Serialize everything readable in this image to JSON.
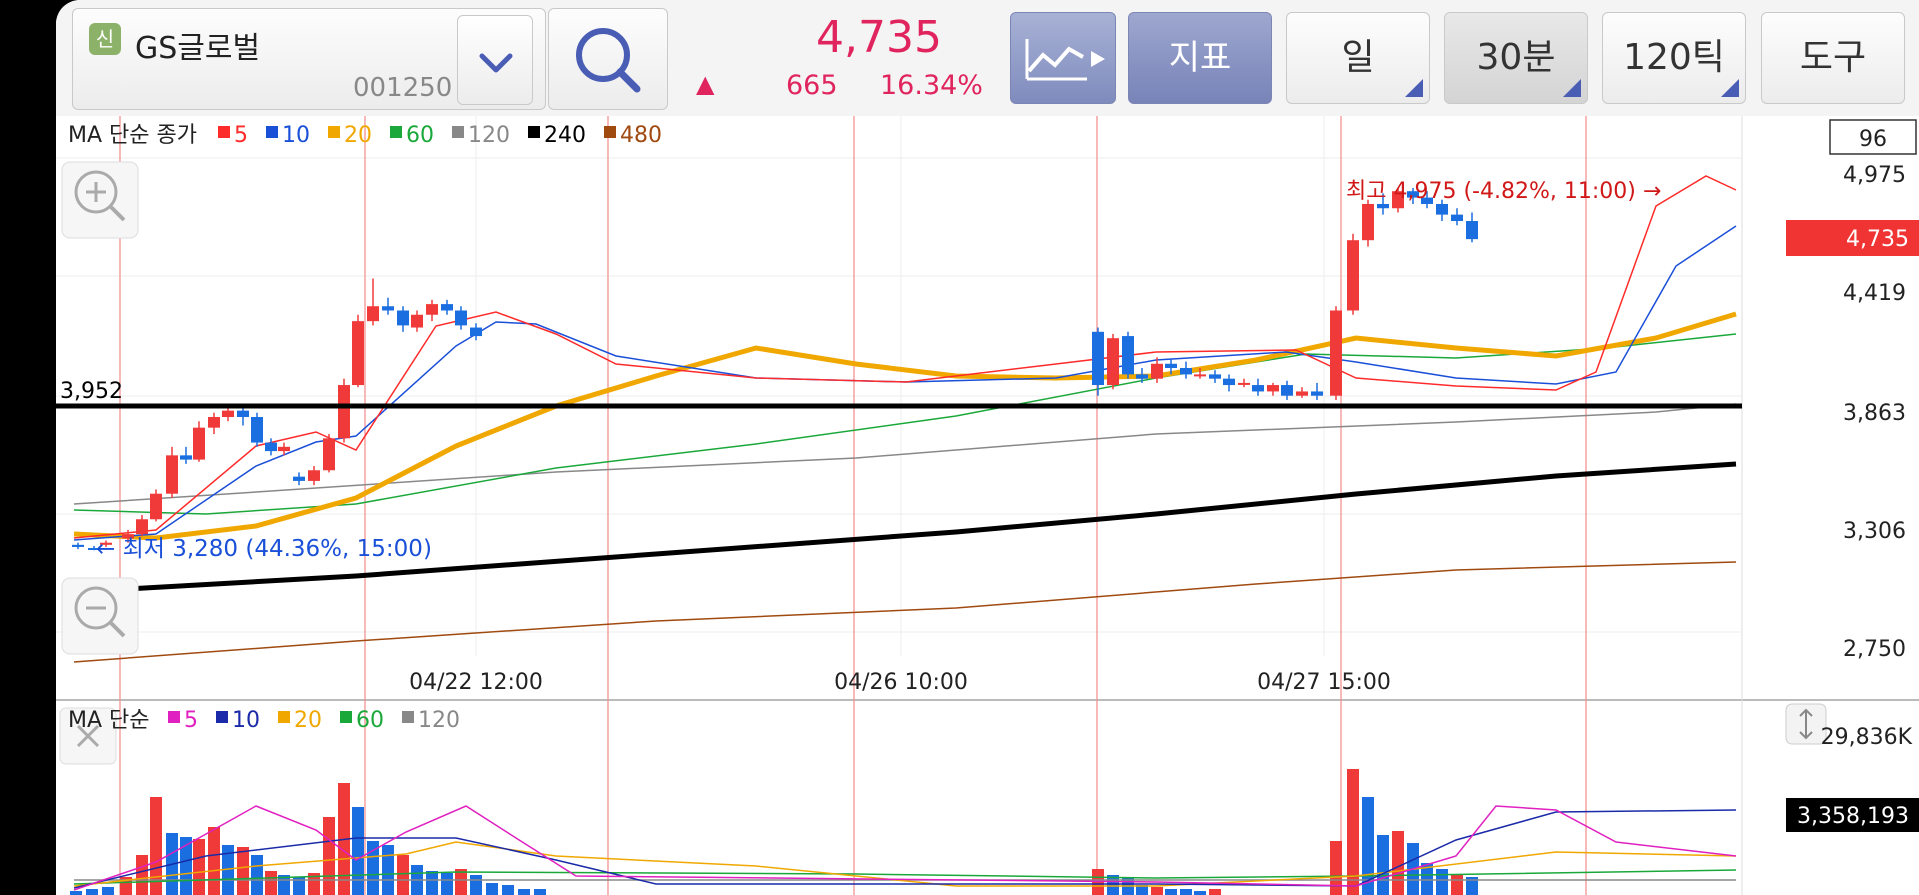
{
  "header": {
    "badge": "신",
    "stock_name": "GS글로벌",
    "stock_code": "001250",
    "price": "4,735",
    "change_arrow": "▲",
    "change_amount": "665",
    "change_percent": "16.34%",
    "indicator_label": "지표",
    "period_day": "일",
    "period_30m": "30분",
    "period_120tick": "120틱",
    "tool_label": "도구"
  },
  "price_panel": {
    "ma_title": "MA 단순 종가",
    "ma_legend": [
      {
        "label": "5",
        "color": "#ff2a2a"
      },
      {
        "label": "10",
        "color": "#1a4fd8"
      },
      {
        "label": "20",
        "color": "#f0a800"
      },
      {
        "label": "60",
        "color": "#1aa83a"
      },
      {
        "label": "120",
        "color": "#888888"
      },
      {
        "label": "240",
        "color": "#000000"
      },
      {
        "label": "480",
        "color": "#a04a10"
      }
    ],
    "count_box": "96",
    "axis_labels": [
      "4,975",
      "4,419",
      "3,863",
      "3,306",
      "2,750"
    ],
    "current_price_tag": "4,735",
    "support_line_label": "3,952",
    "high_annotation": "최고 4,975 (-4.82%, 11:00) →",
    "low_annotation": "← 최저 3,280 (44.36%, 15:00)",
    "date_labels": [
      "04/22 12:00",
      "04/26 10:00",
      "04/27 15:00"
    ]
  },
  "volume_panel": {
    "ma_title": "MA 단순",
    "ma_legend": [
      {
        "label": "5",
        "color": "#e020c0"
      },
      {
        "label": "10",
        "color": "#1a2aa8"
      },
      {
        "label": "20",
        "color": "#f0a800"
      },
      {
        "label": "60",
        "color": "#1aa83a"
      },
      {
        "label": "120",
        "color": "#888888"
      }
    ],
    "axis_top": "29,836K",
    "current_volume": "3,358,193"
  },
  "colors": {
    "up": "#f03a3a",
    "down": "#1a6ee0",
    "accent": "#e0245e",
    "button_blue": "#7f8bbd"
  },
  "icons": [
    "chevron-down-icon",
    "search-icon",
    "line-chart-icon",
    "zoom-in-icon",
    "zoom-out-icon",
    "close-icon",
    "resize-vertical-icon"
  ]
}
